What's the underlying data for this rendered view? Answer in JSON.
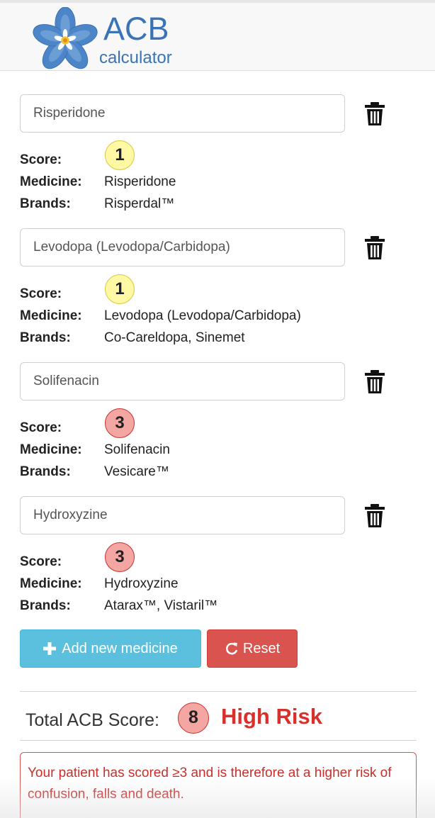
{
  "app": {
    "logo_title": "ACB",
    "logo_subtitle": "calculator"
  },
  "labels": {
    "score": "Score:",
    "medicine": "Medicine:",
    "brands": "Brands:"
  },
  "medicines": [
    {
      "input_value": "Risperidone",
      "score": "1",
      "medicine": "Risperidone",
      "brands": "Risperdal™",
      "badge_color": "#fff9a6",
      "badge_border": "#d6c93a"
    },
    {
      "input_value": "Levodopa (Levodopa/Carbidopa)",
      "score": "1",
      "medicine": "Levodopa (Levodopa/Carbidopa)",
      "brands": "Co-Careldopa, Sinemet",
      "badge_color": "#fff9a6",
      "badge_border": "#d6c93a"
    },
    {
      "input_value": "Solifenacin",
      "score": "3",
      "medicine": "Solifenacin",
      "brands": "Vesicare™",
      "badge_color": "#f4a6a3",
      "badge_border": "#c9302c"
    },
    {
      "input_value": "Hydroxyzine",
      "score": "3",
      "medicine": "Hydroxyzine",
      "brands": "Atarax™, Vistaril™",
      "badge_color": "#f4a6a3",
      "badge_border": "#c9302c"
    }
  ],
  "buttons": {
    "add_label": "Add new medicine",
    "reset_label": "Reset"
  },
  "total": {
    "label": "Total ACB Score:",
    "score": "8",
    "risk": "High Risk"
  },
  "alert": {
    "message": "Your patient has scored ≥3 and is therefore at a higher risk of confusion, falls and death."
  },
  "colors": {
    "brand": "#3a73b6",
    "info": "#5bc0de",
    "danger": "#d9534f"
  }
}
